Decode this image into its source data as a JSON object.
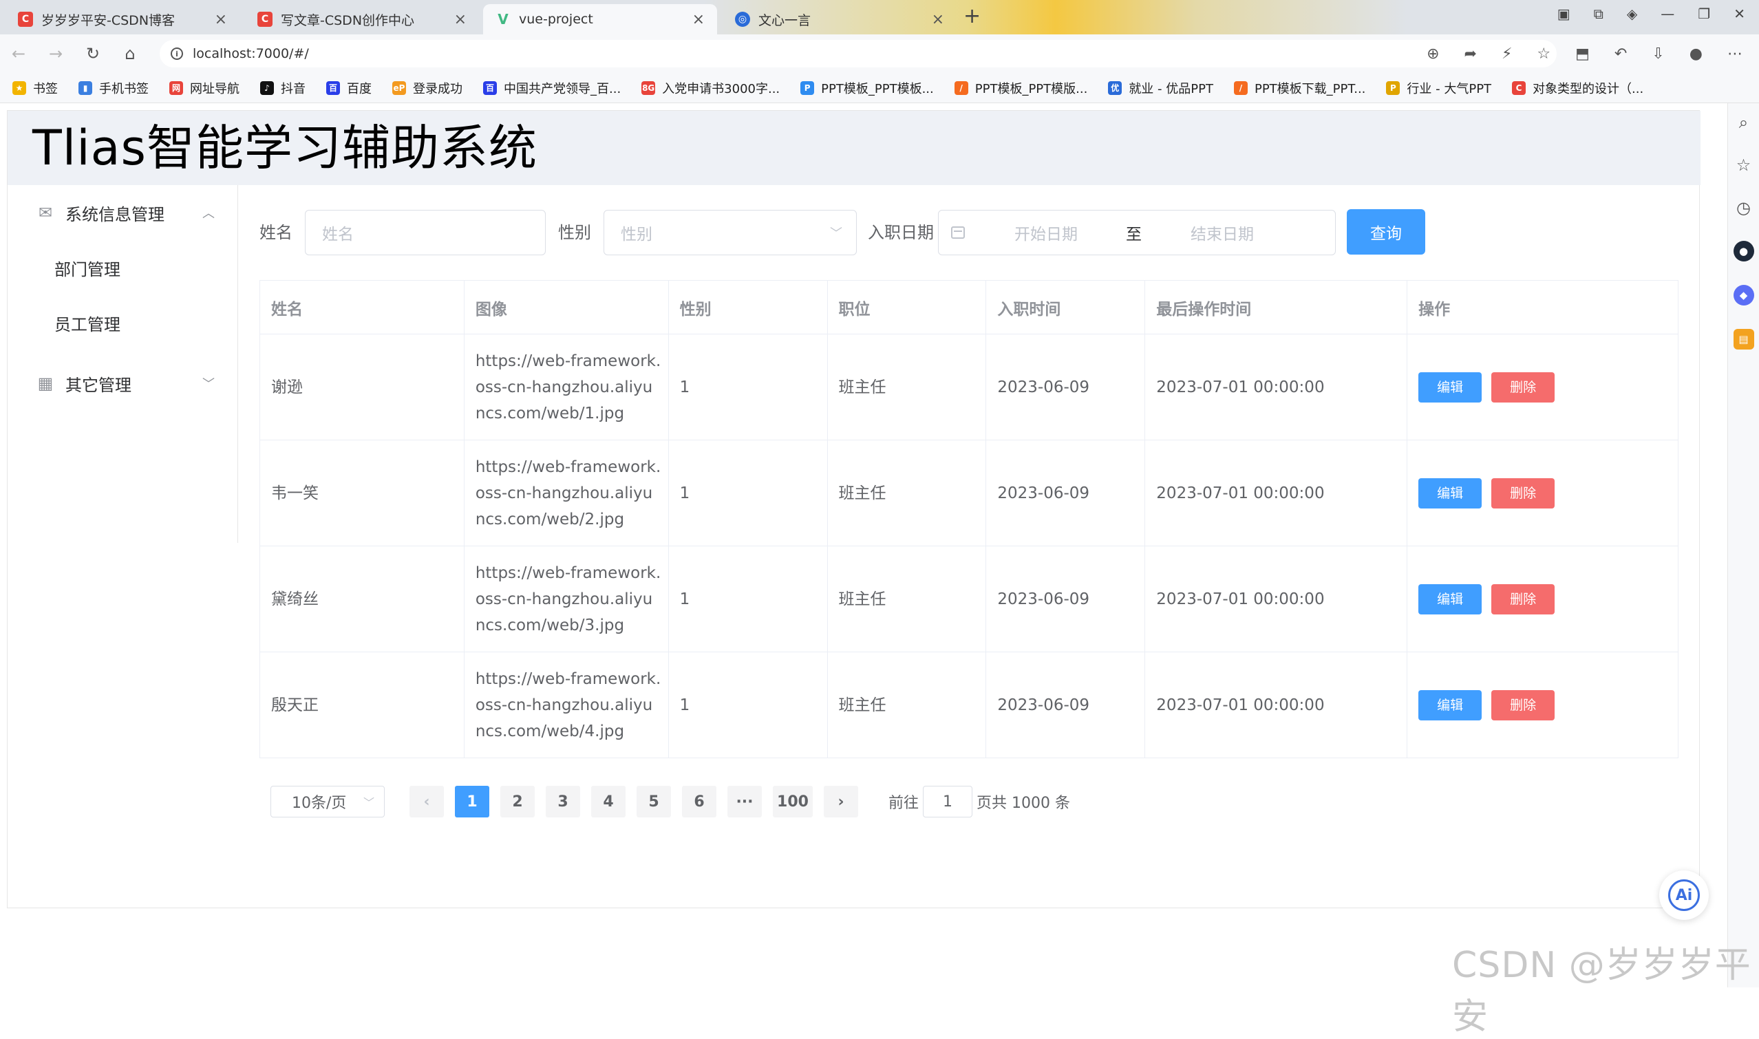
{
  "browser": {
    "tabs": [
      {
        "title": "岁岁岁平安-CSDN博客",
        "favicon": "C",
        "kind": "csdn"
      },
      {
        "title": "写文章-CSDN创作中心",
        "favicon": "C",
        "kind": "csdn"
      },
      {
        "title": "vue-project",
        "favicon": "V",
        "kind": "vue"
      },
      {
        "title": "文心一言",
        "favicon": "◎",
        "kind": "yiyan"
      }
    ],
    "url": "localhost:7000/#/",
    "bookmarks": [
      {
        "label": "书签",
        "icon": "★",
        "color": "#f2b400"
      },
      {
        "label": "手机书签",
        "icon": "▮",
        "color": "#3b7fe0"
      },
      {
        "label": "网址导航",
        "icon": "网",
        "color": "#e8443b"
      },
      {
        "label": "抖音",
        "icon": "♪",
        "color": "#111111"
      },
      {
        "label": "百度",
        "icon": "百",
        "color": "#2a3ee8"
      },
      {
        "label": "登录成功",
        "icon": "eP",
        "color": "#f39a1f"
      },
      {
        "label": "中国共产党领导_百...",
        "icon": "百",
        "color": "#2a3ee8"
      },
      {
        "label": "入党申请书3000字...",
        "icon": "8G",
        "color": "#e8443b"
      },
      {
        "label": "PPT模板_PPT模板...",
        "icon": "P",
        "color": "#2f8cf0"
      },
      {
        "label": "PPT模板_PPT模版...",
        "icon": "/",
        "color": "#f56b1f"
      },
      {
        "label": "就业 - 优品PPT",
        "icon": "优",
        "color": "#2a6bd8"
      },
      {
        "label": "PPT模板下载_PPT...",
        "icon": "/",
        "color": "#f56b1f"
      },
      {
        "label": "行业 - 大气PPT",
        "icon": "P",
        "color": "#e0a500"
      },
      {
        "label": "对象类型的设计（...",
        "icon": "C",
        "color": "#e8443b"
      }
    ]
  },
  "app": {
    "title": "Tlias智能学习辅助系统",
    "menu": {
      "group1": "系统信息管理",
      "sub1": "部门管理",
      "sub2": "员工管理",
      "group2": "其它管理"
    },
    "search": {
      "name_label": "姓名",
      "name_placeholder": "姓名",
      "gender_label": "性别",
      "gender_placeholder": "性别",
      "date_label": "入职日期",
      "date_start_placeholder": "开始日期",
      "date_separator": "至",
      "date_end_placeholder": "结束日期",
      "query_button": "查询"
    },
    "table": {
      "headers": [
        "姓名",
        "图像",
        "性别",
        "职位",
        "入职时间",
        "最后操作时间",
        "操作"
      ],
      "rows": [
        {
          "name": "谢逊",
          "image": "https://web-framework.oss-cn-hangzhou.aliyuncs.com/web/1.jpg",
          "gender": "1",
          "job": "班主任",
          "entry": "2023-06-09",
          "updated": "2023-07-01 00:00:00"
        },
        {
          "name": "韦一笑",
          "image": "https://web-framework.oss-cn-hangzhou.aliyuncs.com/web/2.jpg",
          "gender": "1",
          "job": "班主任",
          "entry": "2023-06-09",
          "updated": "2023-07-01 00:00:00"
        },
        {
          "name": "黛绮丝",
          "image": "https://web-framework.oss-cn-hangzhou.aliyuncs.com/web/3.jpg",
          "gender": "1",
          "job": "班主任",
          "entry": "2023-06-09",
          "updated": "2023-07-01 00:00:00"
        },
        {
          "name": "殷天正",
          "image": "https://web-framework.oss-cn-hangzhou.aliyuncs.com/web/4.jpg",
          "gender": "1",
          "job": "班主任",
          "entry": "2023-06-09",
          "updated": "2023-07-01 00:00:00"
        }
      ],
      "edit_label": "编辑",
      "delete_label": "删除"
    },
    "pagination": {
      "page_size": "10条/页",
      "pages": [
        "1",
        "2",
        "3",
        "4",
        "5",
        "6",
        "···",
        "100"
      ],
      "current": "1",
      "goto_label": "前往",
      "goto_value": "1",
      "total_label": "页共 1000 条"
    }
  },
  "watermark": "CSDN @岁岁岁平安",
  "colors": {
    "primary": "#409eff",
    "danger": "#f56c6c",
    "header_bg": "#eef1f6"
  }
}
